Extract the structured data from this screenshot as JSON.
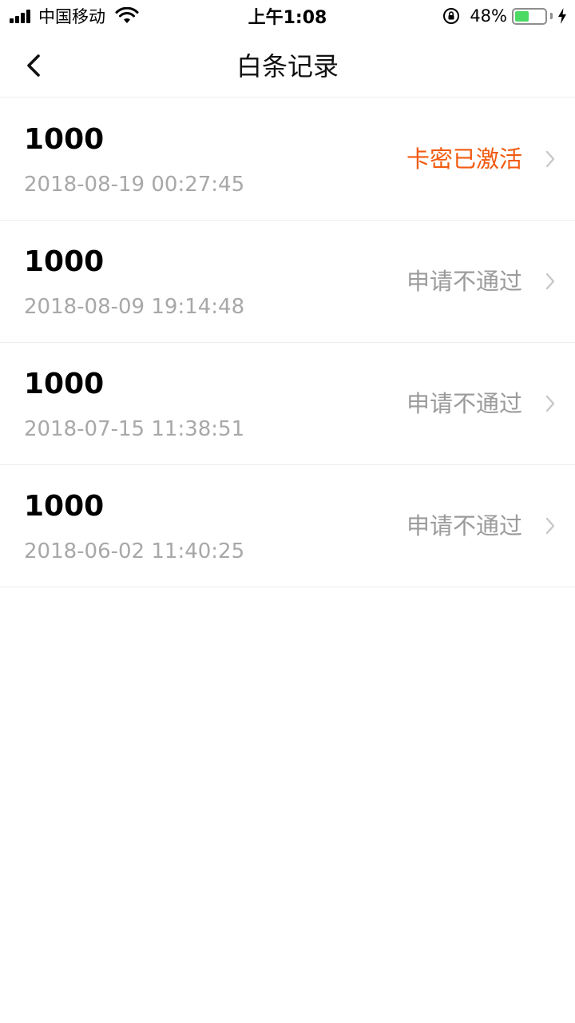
{
  "status_bar": {
    "carrier": "中国移动",
    "time": "上午1:08",
    "battery_percent": "48%",
    "battery_level": 0.48,
    "icons": [
      "signal-icon",
      "wifi-icon",
      "rotation-lock-icon",
      "battery-icon",
      "charging-bolt-icon"
    ]
  },
  "nav": {
    "back_icon": "chevron-left-icon",
    "title": "白条记录"
  },
  "records": [
    {
      "amount": "1000",
      "date": "2018-08-19 00:27:45",
      "status": "卡密已激活",
      "status_kind": "active"
    },
    {
      "amount": "1000",
      "date": "2018-08-09 19:14:48",
      "status": "申请不通过",
      "status_kind": "rejected"
    },
    {
      "amount": "1000",
      "date": "2018-07-15 11:38:51",
      "status": "申请不通过",
      "status_kind": "rejected"
    },
    {
      "amount": "1000",
      "date": "2018-06-02 11:40:25",
      "status": "申请不通过",
      "status_kind": "rejected"
    }
  ],
  "colors": {
    "active_status": "#f25a0f",
    "rejected_status": "#9b9b9b",
    "date_text": "#a8a8a8",
    "battery_fill": "#4cd964"
  }
}
